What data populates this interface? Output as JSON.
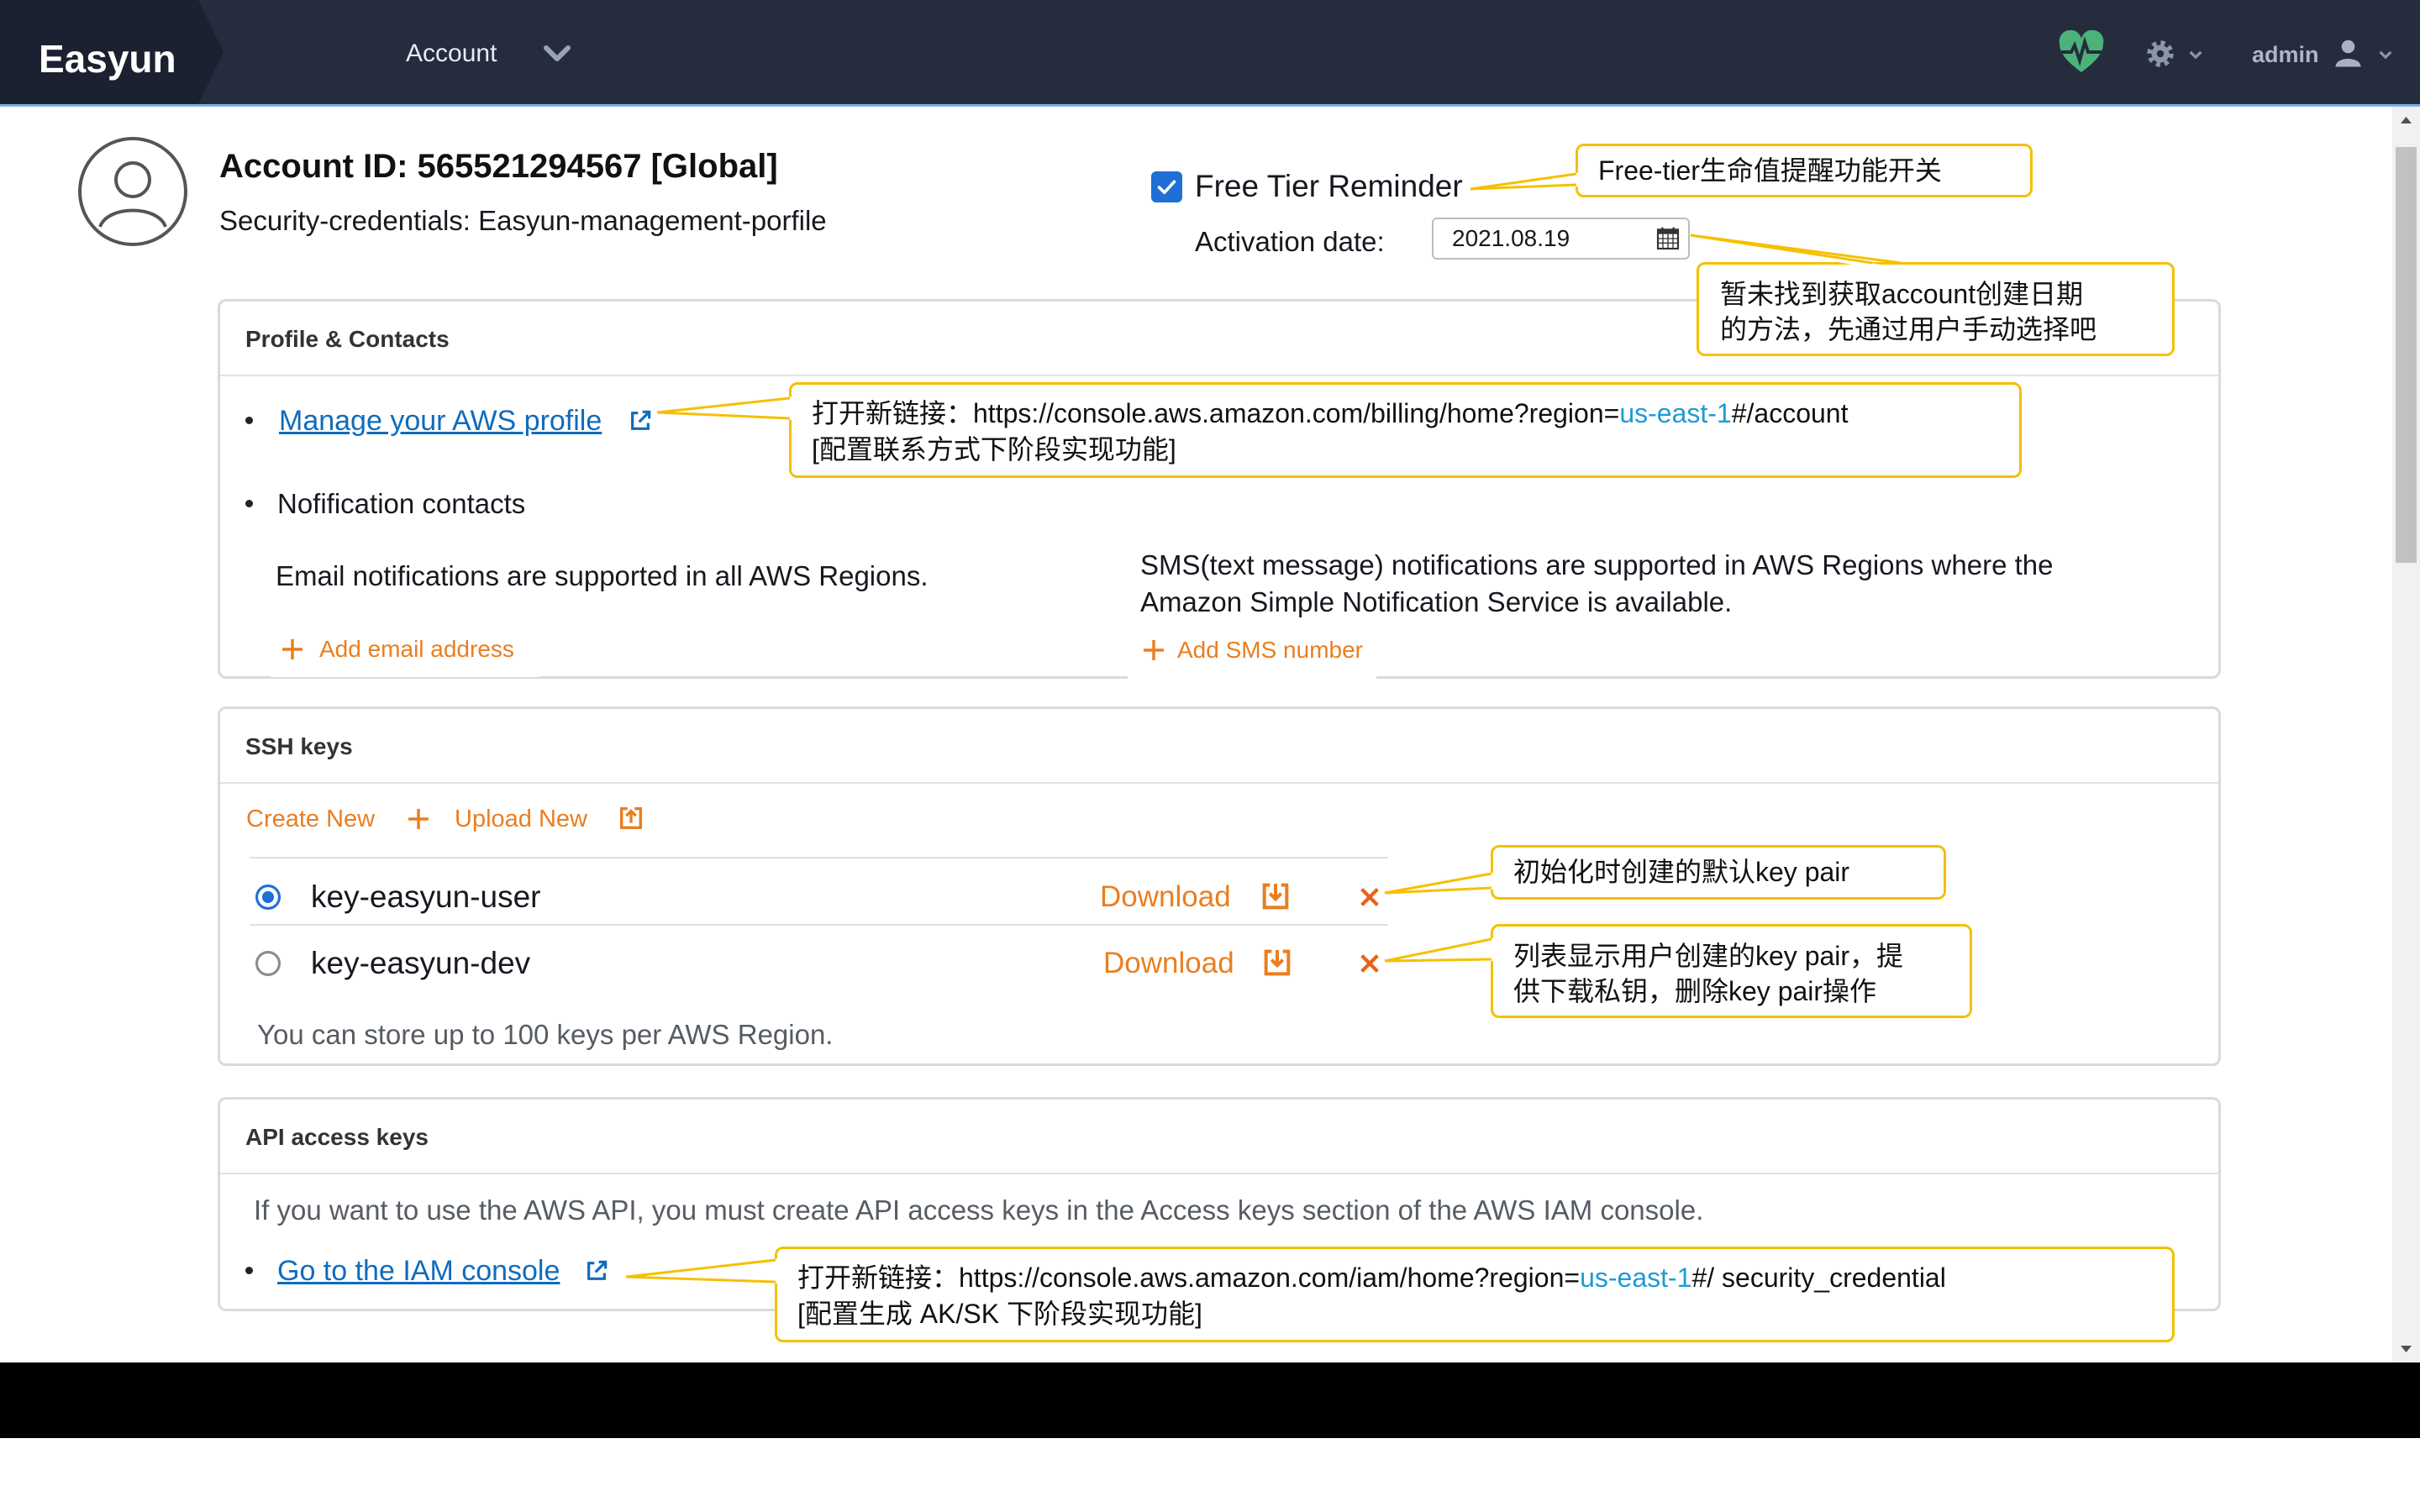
{
  "header": {
    "brand": "Easyun",
    "nav_account": "Account",
    "user_name": "admin",
    "icons": {
      "health": "heart-pulse-icon",
      "settings": "gear-icon",
      "user": "user-icon",
      "menu": "chevron-down-icon"
    }
  },
  "account": {
    "title": "Account ID: 565521294567 [Global]",
    "credentials": "Security-credentials: Easyun-management-porfile",
    "avatar_icon": "user-circle-icon"
  },
  "free_tier": {
    "reminder_enabled": true,
    "label": "Free Tier Reminder",
    "activation_label": "Activation date:",
    "activation_date": "2021.08.19",
    "date_icon": "calendar-icon"
  },
  "profile_contacts": {
    "title": "Profile & Contacts",
    "manage_profile_link": "Manage your AWS profile",
    "notification_contacts": "Nofification contacts",
    "email_note": "Email notifications are supported in all AWS Regions.",
    "add_email": "Add email address",
    "sms_note": [
      "SMS(text message) notifications are supported in AWS Regions where the",
      "Amazon Simple Notification Service is available."
    ],
    "add_sms": "Add SMS number"
  },
  "ssh_keys": {
    "title": "SSH keys",
    "create_new": "Create New",
    "upload_new": "Upload New",
    "keys": [
      {
        "name": "key-easyun-user",
        "selected": true,
        "download": "Download"
      },
      {
        "name": "key-easyun-dev",
        "selected": false,
        "download": "Download"
      }
    ],
    "limit_note": "You can store up to 100 keys per AWS Region."
  },
  "api_access_keys": {
    "title": "API access keys",
    "note": "If you want to use the AWS API, you must create API access keys in the Access keys section of the AWS IAM console.",
    "iam_console_link": "Go to the IAM console"
  },
  "annotations": {
    "free_tier_switch": "Free-tier生命值提醒功能开关",
    "activation_date": [
      "暂未找到获取account创建日期",
      "的方法，先通过用户手动选择吧"
    ],
    "profile_link": {
      "prefix": "打开新链接：https://console.aws.amazon.com/billing/home?region=",
      "region": "us-east-1",
      "suffix": "#/account",
      "line2": "[配置联系方式下阶段实现功能]"
    },
    "default_key": "初始化时创建的默认key pair",
    "key_list": [
      "列表显示用户创建的key pair，提",
      "供下载私钥，删除key pair操作"
    ],
    "iam_link": {
      "prefix": "打开新链接：https://console.aws.amazon.com/iam/home?region=",
      "region": "us-east-1",
      "suffix": "#/ security_credential",
      "line2": "[配置生成 AK/SK 下阶段实现功能]"
    }
  },
  "colors": {
    "header_bg": "#252c3e",
    "accent_orange": "#ea7e1f",
    "link_blue": "#0f6cbd",
    "callout_border": "#f5c000",
    "highlight_blue": "#1f9ad6",
    "check_blue": "#1f6fd6",
    "delete_red": "#e8621a"
  }
}
